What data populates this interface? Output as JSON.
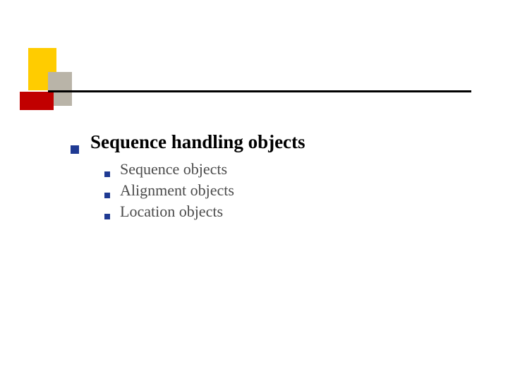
{
  "colors": {
    "accent_yellow": "#ffcc00",
    "accent_grey": "#b9b4a8",
    "accent_red": "#c10000",
    "bullet": "#1f3a93",
    "line": "#000000"
  },
  "main": {
    "heading": "Sequence handling objects",
    "items": [
      {
        "label": "Sequence objects"
      },
      {
        "label": "Alignment objects"
      },
      {
        "label": "Location objects"
      }
    ]
  }
}
